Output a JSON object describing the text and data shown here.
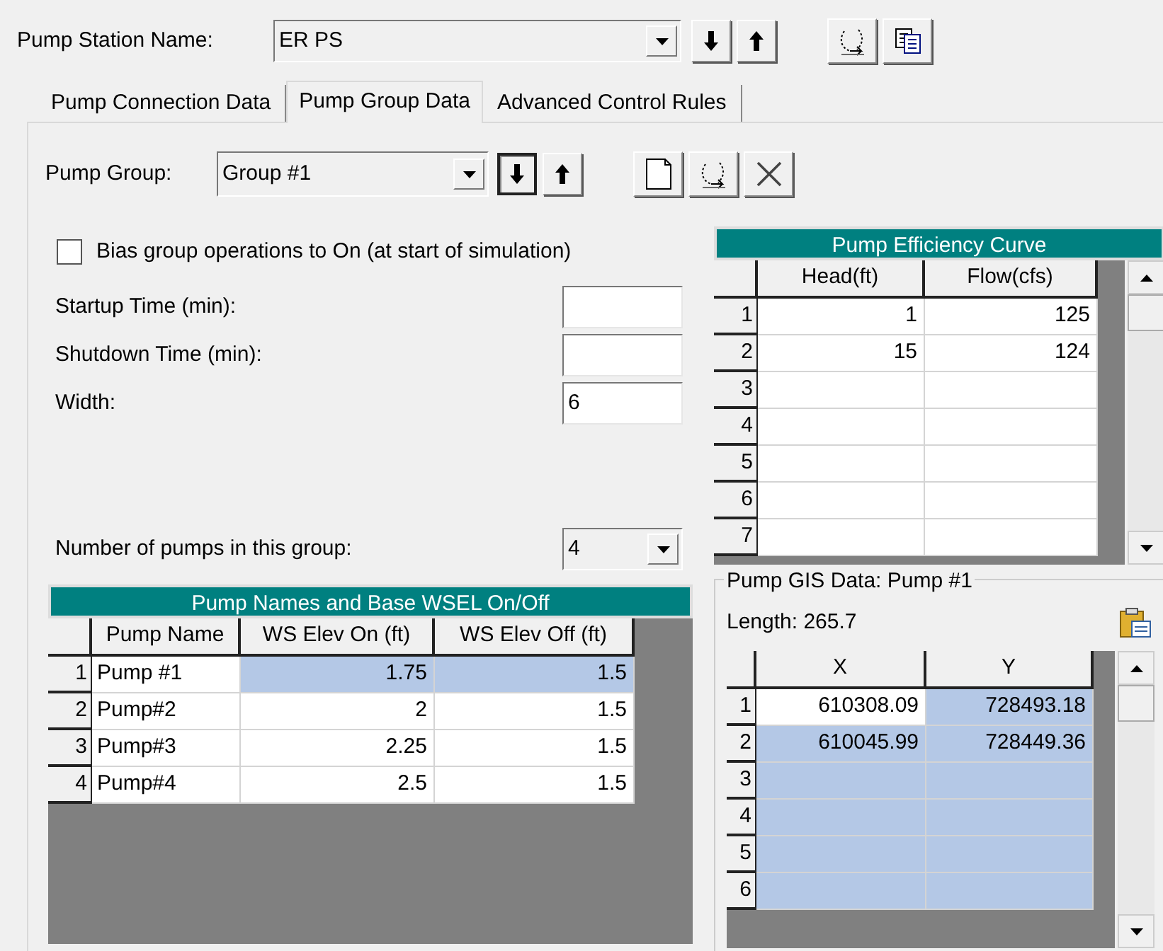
{
  "pump_station": {
    "label": "Pump Station Name:",
    "value": "ER PS"
  },
  "station_buttons": [
    {
      "kind": "down",
      "pressed": false
    },
    {
      "kind": "up",
      "pressed": false
    },
    {
      "kind": "rename",
      "pressed": false
    },
    {
      "kind": "copy",
      "pressed": false
    }
  ],
  "tabs": [
    {
      "label": "Pump Connection Data",
      "selected": false
    },
    {
      "label": "Pump Group Data",
      "selected": true
    },
    {
      "label": "Advanced Control Rules",
      "selected": false
    }
  ],
  "pump_group": {
    "label": "Pump Group:",
    "value": "Group #1"
  },
  "group_buttons": [
    {
      "kind": "down",
      "pressed": true
    },
    {
      "kind": "up",
      "pressed": false
    },
    {
      "kind": "new",
      "pressed": false
    },
    {
      "kind": "rename",
      "pressed": false
    },
    {
      "kind": "delete",
      "pressed": false
    }
  ],
  "bias_checkbox": {
    "label": "Bias group operations to On (at start of simulation)",
    "checked": false
  },
  "fields": [
    {
      "label": "Startup Time (min):"
    },
    {
      "label": "Shutdown Time (min):"
    },
    {
      "label": "Width:",
      "value": "6"
    }
  ],
  "pump_count": {
    "label": "Number of pumps in this group:",
    "value": "4"
  },
  "pump_table": {
    "title": "Pump Names and Base WSEL On/Off",
    "columns": [
      "Pump Name",
      "WS Elev On (ft)",
      "WS Elev Off (ft)"
    ],
    "rows": [
      {
        "row": "1",
        "cells": [
          {
            "value": "Pump #1",
            "selected": false
          },
          {
            "value": "1.75",
            "selected": true
          },
          {
            "value": "1.5",
            "selected": true
          }
        ]
      },
      {
        "row": "2",
        "cells": [
          {
            "value": "Pump#2",
            "selected": false
          },
          {
            "value": "2",
            "selected": false
          },
          {
            "value": "1.5",
            "selected": false
          }
        ]
      },
      {
        "row": "3",
        "cells": [
          {
            "value": "Pump#3",
            "selected": false
          },
          {
            "value": "2.25",
            "selected": false
          },
          {
            "value": "1.5",
            "selected": false
          }
        ]
      },
      {
        "row": "4",
        "cells": [
          {
            "value": "Pump#4",
            "selected": false
          },
          {
            "value": "2.5",
            "selected": false
          },
          {
            "value": "1.5",
            "selected": false
          }
        ]
      }
    ]
  },
  "efficiency_table": {
    "title": "Pump Efficiency Curve",
    "columns": [
      "Head(ft)",
      "Flow(cfs)"
    ],
    "rows": [
      {
        "row": "1",
        "cells": [
          {
            "value": "1",
            "selected": false
          },
          {
            "value": "125",
            "selected": false
          }
        ]
      },
      {
        "row": "2",
        "cells": [
          {
            "value": "15",
            "selected": false
          },
          {
            "value": "124",
            "selected": false
          }
        ]
      },
      {
        "row": "3",
        "cells": [
          {
            "selected": false
          },
          {
            "selected": false
          }
        ]
      },
      {
        "row": "4",
        "cells": [
          {
            "selected": false
          },
          {
            "selected": false
          }
        ]
      },
      {
        "row": "5",
        "cells": [
          {
            "selected": false
          },
          {
            "selected": false
          }
        ]
      },
      {
        "row": "6",
        "cells": [
          {
            "selected": false
          },
          {
            "selected": false
          }
        ]
      },
      {
        "row": "7",
        "cells": [
          {
            "selected": false
          },
          {
            "selected": false
          }
        ]
      }
    ]
  },
  "gis": {
    "title": "Pump GIS Data: Pump #1",
    "length": "Length: 265.7",
    "columns": [
      "X",
      "Y"
    ],
    "rows": [
      {
        "row": "1",
        "cells": [
          {
            "value": "610308.09",
            "selected": false
          },
          {
            "value": "728493.18",
            "selected": true
          }
        ]
      },
      {
        "row": "2",
        "cells": [
          {
            "value": "610045.99",
            "selected": true
          },
          {
            "value": "728449.36",
            "selected": true
          }
        ]
      },
      {
        "row": "3",
        "cells": [
          {
            "selected": true
          },
          {
            "selected": true
          }
        ]
      },
      {
        "row": "4",
        "cells": [
          {
            "selected": true
          },
          {
            "selected": true
          }
        ]
      },
      {
        "row": "5",
        "cells": [
          {
            "selected": true
          },
          {
            "selected": true
          }
        ]
      },
      {
        "row": "6",
        "cells": [
          {
            "selected": true
          },
          {
            "selected": true
          }
        ]
      }
    ]
  }
}
